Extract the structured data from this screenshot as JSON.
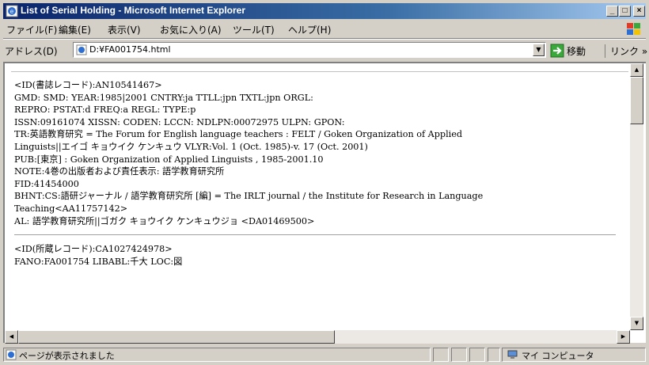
{
  "window": {
    "title": "List of Serial Holding - Microsoft Internet Explorer",
    "controls": {
      "minimize": "_",
      "maximize": "□",
      "close": "×"
    }
  },
  "menu": [
    "ファイル(F)",
    "編集(E)",
    "表示(V)",
    "お気に入り(A)",
    "ツール(T)",
    "ヘルプ(H)"
  ],
  "address": {
    "label": "アドレス(D)",
    "value": "D:¥FA001754.html",
    "go_label": "移動",
    "links_label": "リンク »"
  },
  "document": {
    "record1": [
      "<ID(書誌レコード):AN10541467>",
      "GMD: SMD: YEAR:1985|2001 CNTRY:ja TTLL:jpn TXTL:jpn ORGL:",
      "REPRO: PSTAT:d FREQ:a REGL: TYPE:p",
      "ISSN:09161074 XISSN: CODEN: LCCN: NDLPN:00072975 ULPN: GPON:",
      "TR:英語教育研究 = The Forum for English language teachers : FELT / Goken Organization of Applied",
      "Linguists||エイゴ キョウイク ケンキュウ VLYR:Vol. 1 (Oct. 1985)-v. 17 (Oct. 2001)",
      "PUB:[東京] : Goken Organization of Applied Linguists , 1985-2001.10",
      "NOTE:4巻の出版者および責任表示: 語学教育研究所",
      "FID:41454000",
      "BHNT:CS:語研ジャーナル / 語学教育研究所 [編] = The IRLT journal / the Institute for Research in Language",
      "Teaching<AA11757142>",
      "AL: 語学教育研究所||ゴガク キョウイク ケンキュウジョ <DA01469500>"
    ],
    "record2": [
      "<ID(所蔵レコード):CA1027424978>",
      "FANO:FA001754 LIBABL:千大 LOC:図"
    ]
  },
  "status": {
    "text": "ページが表示されました",
    "zone": "マイ コンピュータ"
  }
}
